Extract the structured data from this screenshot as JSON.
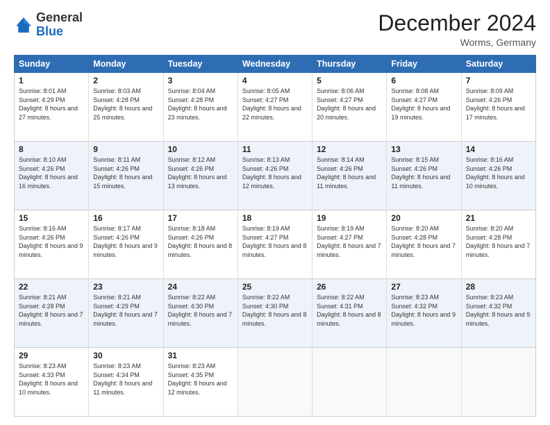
{
  "logo": {
    "general": "General",
    "blue": "Blue"
  },
  "header": {
    "month_title": "December 2024",
    "location": "Worms, Germany"
  },
  "days_of_week": [
    "Sunday",
    "Monday",
    "Tuesday",
    "Wednesday",
    "Thursday",
    "Friday",
    "Saturday"
  ],
  "weeks": [
    [
      {
        "day": "1",
        "sunrise": "8:01 AM",
        "sunset": "4:29 PM",
        "daylight": "8 hours and 27 minutes."
      },
      {
        "day": "2",
        "sunrise": "8:03 AM",
        "sunset": "4:28 PM",
        "daylight": "8 hours and 25 minutes."
      },
      {
        "day": "3",
        "sunrise": "8:04 AM",
        "sunset": "4:28 PM",
        "daylight": "8 hours and 23 minutes."
      },
      {
        "day": "4",
        "sunrise": "8:05 AM",
        "sunset": "4:27 PM",
        "daylight": "8 hours and 22 minutes."
      },
      {
        "day": "5",
        "sunrise": "8:06 AM",
        "sunset": "4:27 PM",
        "daylight": "8 hours and 20 minutes."
      },
      {
        "day": "6",
        "sunrise": "8:08 AM",
        "sunset": "4:27 PM",
        "daylight": "8 hours and 19 minutes."
      },
      {
        "day": "7",
        "sunrise": "8:09 AM",
        "sunset": "4:26 PM",
        "daylight": "8 hours and 17 minutes."
      }
    ],
    [
      {
        "day": "8",
        "sunrise": "8:10 AM",
        "sunset": "4:26 PM",
        "daylight": "8 hours and 16 minutes."
      },
      {
        "day": "9",
        "sunrise": "8:11 AM",
        "sunset": "4:26 PM",
        "daylight": "8 hours and 15 minutes."
      },
      {
        "day": "10",
        "sunrise": "8:12 AM",
        "sunset": "4:26 PM",
        "daylight": "8 hours and 13 minutes."
      },
      {
        "day": "11",
        "sunrise": "8:13 AM",
        "sunset": "4:26 PM",
        "daylight": "8 hours and 12 minutes."
      },
      {
        "day": "12",
        "sunrise": "8:14 AM",
        "sunset": "4:26 PM",
        "daylight": "8 hours and 11 minutes."
      },
      {
        "day": "13",
        "sunrise": "8:15 AM",
        "sunset": "4:26 PM",
        "daylight": "8 hours and 11 minutes."
      },
      {
        "day": "14",
        "sunrise": "8:16 AM",
        "sunset": "4:26 PM",
        "daylight": "8 hours and 10 minutes."
      }
    ],
    [
      {
        "day": "15",
        "sunrise": "8:16 AM",
        "sunset": "4:26 PM",
        "daylight": "8 hours and 9 minutes."
      },
      {
        "day": "16",
        "sunrise": "8:17 AM",
        "sunset": "4:26 PM",
        "daylight": "8 hours and 9 minutes."
      },
      {
        "day": "17",
        "sunrise": "8:18 AM",
        "sunset": "4:26 PM",
        "daylight": "8 hours and 8 minutes."
      },
      {
        "day": "18",
        "sunrise": "8:19 AM",
        "sunset": "4:27 PM",
        "daylight": "8 hours and 8 minutes."
      },
      {
        "day": "19",
        "sunrise": "8:19 AM",
        "sunset": "4:27 PM",
        "daylight": "8 hours and 7 minutes."
      },
      {
        "day": "20",
        "sunrise": "8:20 AM",
        "sunset": "4:28 PM",
        "daylight": "8 hours and 7 minutes."
      },
      {
        "day": "21",
        "sunrise": "8:20 AM",
        "sunset": "4:28 PM",
        "daylight": "8 hours and 7 minutes."
      }
    ],
    [
      {
        "day": "22",
        "sunrise": "8:21 AM",
        "sunset": "4:28 PM",
        "daylight": "8 hours and 7 minutes."
      },
      {
        "day": "23",
        "sunrise": "8:21 AM",
        "sunset": "4:29 PM",
        "daylight": "8 hours and 7 minutes."
      },
      {
        "day": "24",
        "sunrise": "8:22 AM",
        "sunset": "4:30 PM",
        "daylight": "8 hours and 7 minutes."
      },
      {
        "day": "25",
        "sunrise": "8:22 AM",
        "sunset": "4:30 PM",
        "daylight": "8 hours and 8 minutes."
      },
      {
        "day": "26",
        "sunrise": "8:22 AM",
        "sunset": "4:31 PM",
        "daylight": "8 hours and 8 minutes."
      },
      {
        "day": "27",
        "sunrise": "8:23 AM",
        "sunset": "4:32 PM",
        "daylight": "8 hours and 9 minutes."
      },
      {
        "day": "28",
        "sunrise": "8:23 AM",
        "sunset": "4:32 PM",
        "daylight": "8 hours and 9 minutes."
      }
    ],
    [
      {
        "day": "29",
        "sunrise": "8:23 AM",
        "sunset": "4:33 PM",
        "daylight": "8 hours and 10 minutes."
      },
      {
        "day": "30",
        "sunrise": "8:23 AM",
        "sunset": "4:34 PM",
        "daylight": "8 hours and 11 minutes."
      },
      {
        "day": "31",
        "sunrise": "8:23 AM",
        "sunset": "4:35 PM",
        "daylight": "8 hours and 12 minutes."
      },
      null,
      null,
      null,
      null
    ]
  ],
  "labels": {
    "sunrise": "Sunrise:",
    "sunset": "Sunset:",
    "daylight": "Daylight:"
  }
}
